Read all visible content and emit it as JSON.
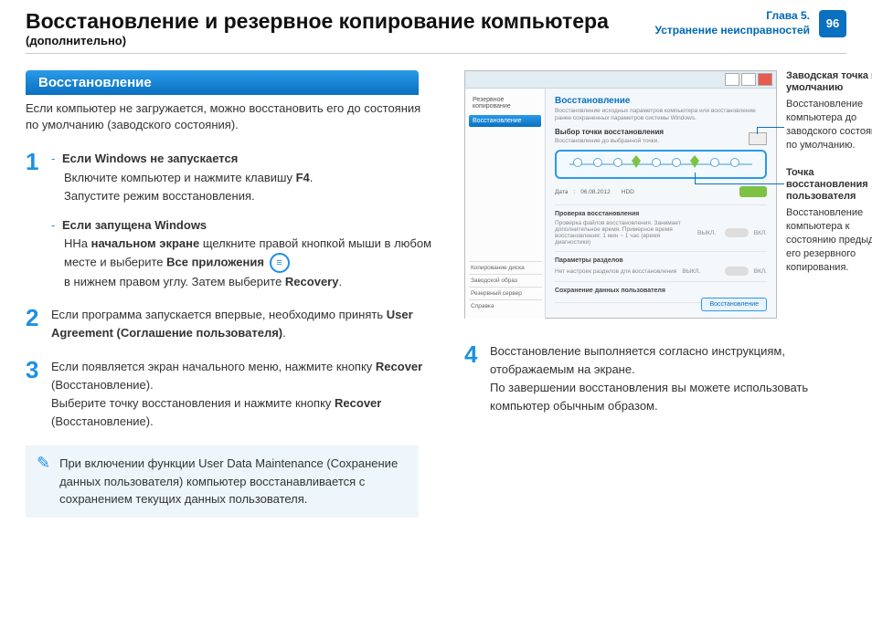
{
  "header": {
    "title": "Восстановление и резервное копирование компьютера",
    "subtitle": "(дополнительно)",
    "chapter_line1": "Глава 5.",
    "chapter_line2": "Устранение неисправностей",
    "page": "96"
  },
  "section": {
    "tab": "Восстановление",
    "intro": "Если компьютер не загружается, можно восстановить его до состояния по умолчанию (заводского состояния)."
  },
  "step1": {
    "num": "1",
    "a_title": "Если Windows не запускается",
    "a_l1": "Включите компьютер и нажмите клавишу ",
    "a_key": "F4",
    "a_l2": "Запустите режим восстановления.",
    "b_title": "Если запущена Windows",
    "b_l1a": "ННа ",
    "b_bold1": "начальном экране",
    "b_l1b": " щелкните правой кнопкой мыши в любом месте и выберите ",
    "b_bold2": "Все приложения",
    "b_l2a": "в нижнем правом углу. Затем выберите ",
    "b_bold3": "Recovery",
    "icon_glyph": "≡"
  },
  "step2": {
    "num": "2",
    "text_a": "Если программа запускается впервые, необходимо принять ",
    "bold": "User Agreement (Соглашение пользователя)"
  },
  "step3": {
    "num": "3",
    "l1a": "Если появляется экран начального меню, нажмите кнопку ",
    "b1": "Recover",
    "l1b": " (Восстановление).",
    "l2a": "Выберите точку восстановления и нажмите кнопку ",
    "b2": "Recover",
    "l2b": " (Восстановление)."
  },
  "note": {
    "text": "При включении функции User Data Maintenance (Сохранение данных пользователя) компьютер восстанавливается с сохранением текущих данных пользователя."
  },
  "step4": {
    "num": "4",
    "l1": "Восстановление выполняется согласно инструкциям, отображаемым на экране.",
    "l2": "По завершении восстановления вы можете использовать компьютер обычным образом."
  },
  "callout1": {
    "title": "Заводская точка по умолчанию",
    "desc": "Восстановление компьютера до заводского состояния по умолчанию."
  },
  "callout2": {
    "title": "Точка восстановления пользователя",
    "desc": "Восстановление компьютера к состоянию предыдущ его резервного копирования."
  },
  "shot": {
    "side_backup": "Резервное копирование",
    "side_restore": "Восстановление",
    "side_b1": "Копирование диска",
    "side_b2": "Заводской образ",
    "side_b3": "Резервный сервер",
    "side_b4": "Справка",
    "main_title": "Восстановление",
    "main_sub": "Восстановление исходных параметров компьютера или восстановление ранее сохраненных параметров системы Windows.",
    "sec_title": "Выбор точки восстановления",
    "sec_sub": "Восстановление до выбранной точки.",
    "date_label": "Дата",
    "date_val": "06.08.2012",
    "drive_label": "HDD",
    "opt1_head": "Проверка восстановления",
    "opt1_desc": "Проверка файлов восстановления. Занимает дополнительное время. Примерное время восстановления: 1 мин ~ 1 час (время диагностики)",
    "opt2_head": "Параметры разделов",
    "opt2_desc": "Нет настроек разделов для восстановления",
    "opt3_head": "Сохранение данных пользователя",
    "off": "ВЫКЛ.",
    "on": "ВКЛ.",
    "btn": "Восстановление"
  }
}
